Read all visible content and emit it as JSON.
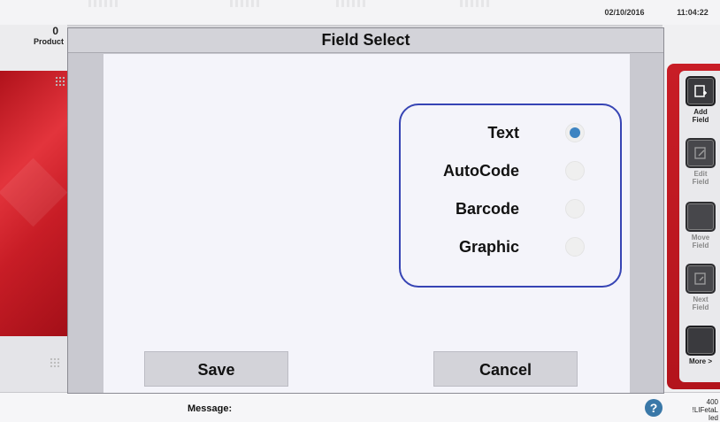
{
  "header": {
    "date": "02/10/2016",
    "time": "11:04:22"
  },
  "product_panel": {
    "count": "0",
    "label": "Product"
  },
  "dialog": {
    "title": "Field Select",
    "options": [
      {
        "label": "Text",
        "selected": true
      },
      {
        "label": "AutoCode",
        "selected": false
      },
      {
        "label": "Barcode",
        "selected": false
      },
      {
        "label": "Graphic",
        "selected": false
      }
    ],
    "save_label": "Save",
    "cancel_label": "Cancel",
    "accent_color": "#3644b4",
    "radio_selected_color": "#3d84c2"
  },
  "sidebar": {
    "buttons": [
      {
        "line1": "Add",
        "line2": "Field",
        "icon": "add-field-icon",
        "enabled": true
      },
      {
        "line1": "Edit",
        "line2": "Field",
        "icon": "edit-field-icon",
        "enabled": false
      },
      {
        "line1": "Move",
        "line2": "Field",
        "icon": "move-field-icon",
        "enabled": false
      },
      {
        "line1": "Next",
        "line2": "Field",
        "icon": "next-field-icon",
        "enabled": false
      },
      {
        "line1": "More >",
        "line2": "",
        "icon": "more-icon",
        "enabled": true
      }
    ]
  },
  "footer": {
    "message_label": "Message:",
    "count": "400",
    "count_sub": "!LIFetaL Ied"
  }
}
